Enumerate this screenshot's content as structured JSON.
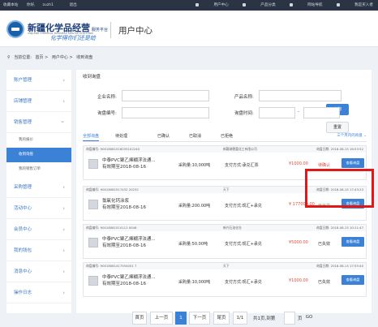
{
  "topbar": {
    "bookmark": "收藏本站",
    "greeting": "你好,",
    "user": "zuzh1",
    "logout": "退出",
    "user_center": "用户中心",
    "product_cat": "产品分类",
    "nav": "网站导航",
    "buyer": "我是买入者"
  },
  "header": {
    "brand": "新疆化学品经营",
    "brand_small": "服务平台",
    "sub": "XINJIANG CHEMICAL BUSINESS SERVICE PLATFORM",
    "signature": "化学得你们还是给",
    "title": "用户中心"
  },
  "breadcrumb": [
    "当前位置:",
    "首页 >",
    "用户中心 >",
    "收到询盘"
  ],
  "sidebar": [
    {
      "label": "账户管理",
      "open": false,
      "items": []
    },
    {
      "label": "店铺管理",
      "open": false,
      "items": []
    },
    {
      "label": "销售管理",
      "open": true,
      "items": [
        {
          "label": "我的报价",
          "active": false
        },
        {
          "label": "收到询盘",
          "active": true
        },
        {
          "label": "我的销售订单",
          "active": false
        }
      ]
    },
    {
      "label": "采购管理",
      "open": false,
      "items": []
    },
    {
      "label": "活动中心",
      "open": false,
      "items": []
    },
    {
      "label": "会员中心",
      "open": false,
      "items": []
    },
    {
      "label": "我的钱包",
      "open": false,
      "items": []
    },
    {
      "label": "消息中心",
      "open": false,
      "items": []
    },
    {
      "label": "操作日志",
      "open": false,
      "items": []
    }
  ],
  "main": {
    "title": "收到询盘"
  },
  "form": {
    "company_label": "企业名称:",
    "product_label": "产品名称:",
    "inquiry_no_label": "询盘编号:",
    "inquiry_time_label": "询盘时间:",
    "query_btn": "查询",
    "reset_btn": "重置",
    "date_sep": "-"
  },
  "tabs": [
    "全部询盘",
    "待处理",
    "已确认",
    "已取消",
    "已拒绝"
  ],
  "tab_sort": "三个月内的询盘 ⌄",
  "orders": [
    {
      "no": "询盘编号: 90018081516035102240",
      "company": "新疆瑞德富化工有限公司",
      "date": "询盘日期: 2018-08-15 16:53:52",
      "name": "中泰PVC聚乙烯糊浮法通...",
      "valid": "有效期至2018-08-16",
      "qty": "采购量:10,000吨",
      "pay": "支付方式:承兑汇票",
      "amount": "¥1000.00",
      "status": "待确认",
      "status_color": "red",
      "btn": "查看询盘"
    },
    {
      "no": "询盘编号: 90018081517432 20232",
      "company": "天下",
      "date": "询盘日期: 2018-08-15 17:43:23",
      "name": "氯氧化钙涂浆",
      "valid": "有效期至2018-08-16",
      "qty": "采购量:200.00吨",
      "pay": "支付方式:现汇+承兑",
      "amount": "¥ 177000.00",
      "status": "已出货",
      "status_color": "green",
      "btn": "查看询盘"
    },
    {
      "no": "询盘编号: 90018081510112 0046",
      "company": "新兴石油化仓",
      "date": "询盘日期: 2018-08-15 10:11:47",
      "name": "中泰PVC聚乙烯糊浮法通...",
      "valid": "有效期至2018-08-16",
      "qty": "采购量:50.00吨",
      "pay": "支付方式:现汇+承兑",
      "amount": "¥5000.00",
      "status": "已失效",
      "status_color": "gray",
      "btn": "查看询盘"
    },
    {
      "no": "询盘编号: 90018081417554001 7",
      "company": "天下",
      "date": "询盘日期: 2018-08-14 17:55:40",
      "name": "中泰PVC聚乙烯糊浮法通...",
      "valid": "有效期至2018-08-16",
      "qty": "采购量:10,000吨",
      "pay": "支付方式:现汇+承兑",
      "amount": "¥1000.00",
      "status": "已失效",
      "status_color": "gray",
      "btn": "查看询盘"
    }
  ],
  "pager": {
    "first": "首页",
    "prev": "上一页",
    "current": "1",
    "next": "下一页",
    "last": "尾页",
    "count": "1/1",
    "total": "共1页,到第",
    "page_unit": "页",
    "go": "GO"
  }
}
